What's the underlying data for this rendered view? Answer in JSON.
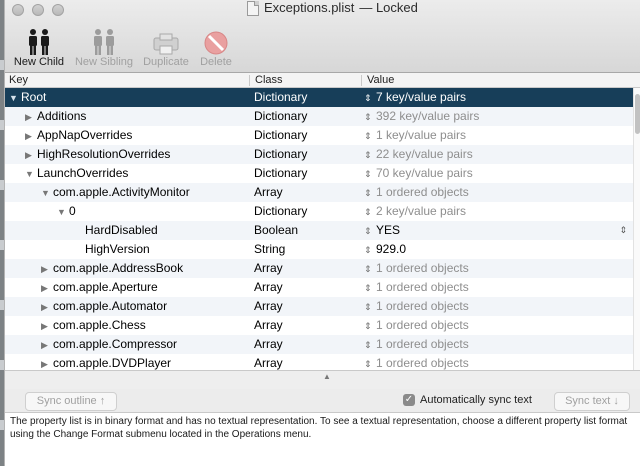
{
  "window": {
    "title": "Exceptions.plist",
    "title_suffix": "— Locked"
  },
  "toolbar": {
    "buttons": [
      {
        "label": "New Child",
        "icon": "two-people-icon",
        "enabled": true
      },
      {
        "label": "New Sibling",
        "icon": "two-people-icon",
        "enabled": false
      },
      {
        "label": "Duplicate",
        "icon": "duplicate-icon",
        "enabled": false
      },
      {
        "label": "Delete",
        "icon": "delete-icon",
        "enabled": false
      }
    ]
  },
  "columns": {
    "key": "Key",
    "class": "Class",
    "value": "Value"
  },
  "rows": [
    {
      "key": "Root",
      "class": "Dictionary",
      "value": "7 key/value pairs",
      "triangle": "expanded",
      "dim": false
    },
    {
      "key": "Additions",
      "class": "Dictionary",
      "value": "392 key/value pairs",
      "triangle": "collapsed",
      "dim": true
    },
    {
      "key": "AppNapOverrides",
      "class": "Dictionary",
      "value": "1 key/value pairs",
      "triangle": "collapsed",
      "dim": true
    },
    {
      "key": "HighResolutionOverrides",
      "class": "Dictionary",
      "value": "22 key/value pairs",
      "triangle": "collapsed",
      "dim": true
    },
    {
      "key": "LaunchOverrides",
      "class": "Dictionary",
      "value": "70 key/value pairs",
      "triangle": "expanded",
      "dim": true
    },
    {
      "key": "com.apple.ActivityMonitor",
      "class": "Array",
      "value": "1 ordered objects",
      "triangle": "expanded",
      "dim": true
    },
    {
      "key": "0",
      "class": "Dictionary",
      "value": "2 key/value pairs",
      "triangle": "expanded",
      "dim": true
    },
    {
      "key": "HardDisabled",
      "class": "Boolean",
      "value": "YES",
      "triangle": "none",
      "dim": false
    },
    {
      "key": "HighVersion",
      "class": "String",
      "value": "929.0",
      "triangle": "none",
      "dim": false
    },
    {
      "key": "com.apple.AddressBook",
      "class": "Array",
      "value": "1 ordered objects",
      "triangle": "collapsed",
      "dim": true
    },
    {
      "key": "com.apple.Aperture",
      "class": "Array",
      "value": "1 ordered objects",
      "triangle": "collapsed",
      "dim": true
    },
    {
      "key": "com.apple.Automator",
      "class": "Array",
      "value": "1 ordered objects",
      "triangle": "collapsed",
      "dim": true
    },
    {
      "key": "com.apple.Chess",
      "class": "Array",
      "value": "1 ordered objects",
      "triangle": "collapsed",
      "dim": true
    },
    {
      "key": "com.apple.Compressor",
      "class": "Array",
      "value": "1 ordered objects",
      "triangle": "collapsed",
      "dim": true
    },
    {
      "key": "com.apple.DVDPlayer",
      "class": "Array",
      "value": "1 ordered objects",
      "triangle": "collapsed",
      "dim": true
    }
  ],
  "bottom": {
    "sync_outline": "Sync outline ↑",
    "auto_sync_label": "Automatically sync text",
    "auto_sync_checked": true,
    "sync_text": "Sync text ↓"
  },
  "text_view": "The property list is in binary format and has no textual representation.  To see a textual representation, choose a different property list format using the Change Format submenu located in the Operations menu.",
  "colors": {
    "selection": "#173e59",
    "dim_value": "#8e8e8e",
    "alt_row": "#f2f5f9"
  }
}
